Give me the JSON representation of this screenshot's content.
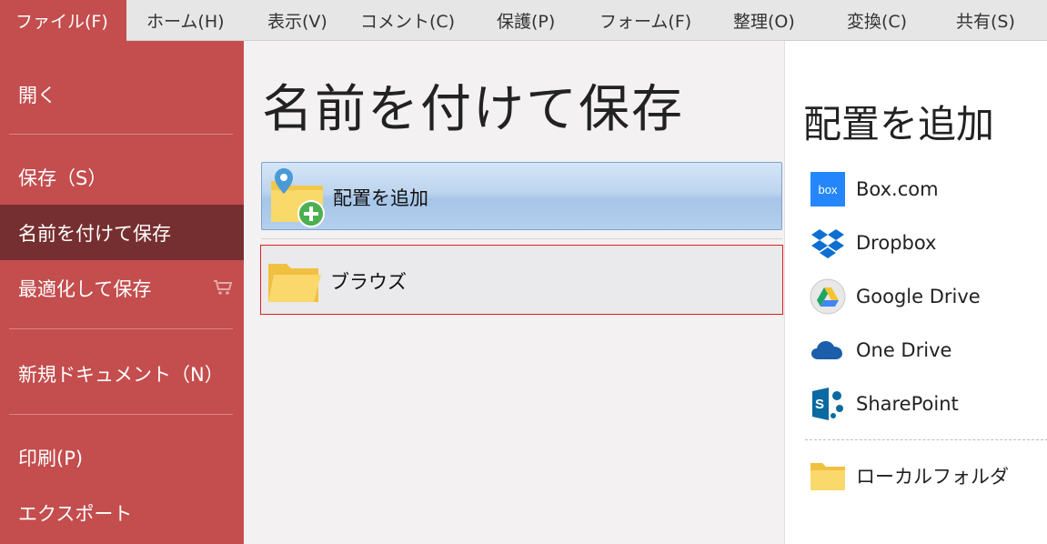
{
  "menu": {
    "tabs": [
      "ファイル(F)",
      "ホーム(H)",
      "表示(V)",
      "コメント(C)",
      "保護(P)",
      "フォーム(F)",
      "整理(O)",
      "変換(C)",
      "共有(S)"
    ]
  },
  "sidebar": {
    "items": [
      "開く",
      "保存（S）",
      "名前を付けて保存",
      "最適化して保存",
      "新規ドキュメント（N）",
      "印刷(P)",
      "エクスポート"
    ],
    "selected": "名前を付けて保存"
  },
  "main": {
    "title": "名前を付けて保存",
    "add_location_label": "配置を追加",
    "browse_label": "ブラウズ"
  },
  "right": {
    "title": "配置を追加",
    "locations": [
      {
        "label": "Box.com",
        "icon": "box-icon"
      },
      {
        "label": "Dropbox",
        "icon": "dropbox-icon"
      },
      {
        "label": "Google Drive",
        "icon": "google-drive-icon"
      },
      {
        "label": "One Drive",
        "icon": "onedrive-icon"
      },
      {
        "label": "SharePoint",
        "icon": "sharepoint-icon"
      }
    ],
    "local_folder_label": "ローカルフォルダ"
  },
  "colors": {
    "accent": "#c44d4e",
    "selected": "#762f30",
    "highlight_border": "#e01f1f",
    "button_blue": "#b4cfed"
  }
}
